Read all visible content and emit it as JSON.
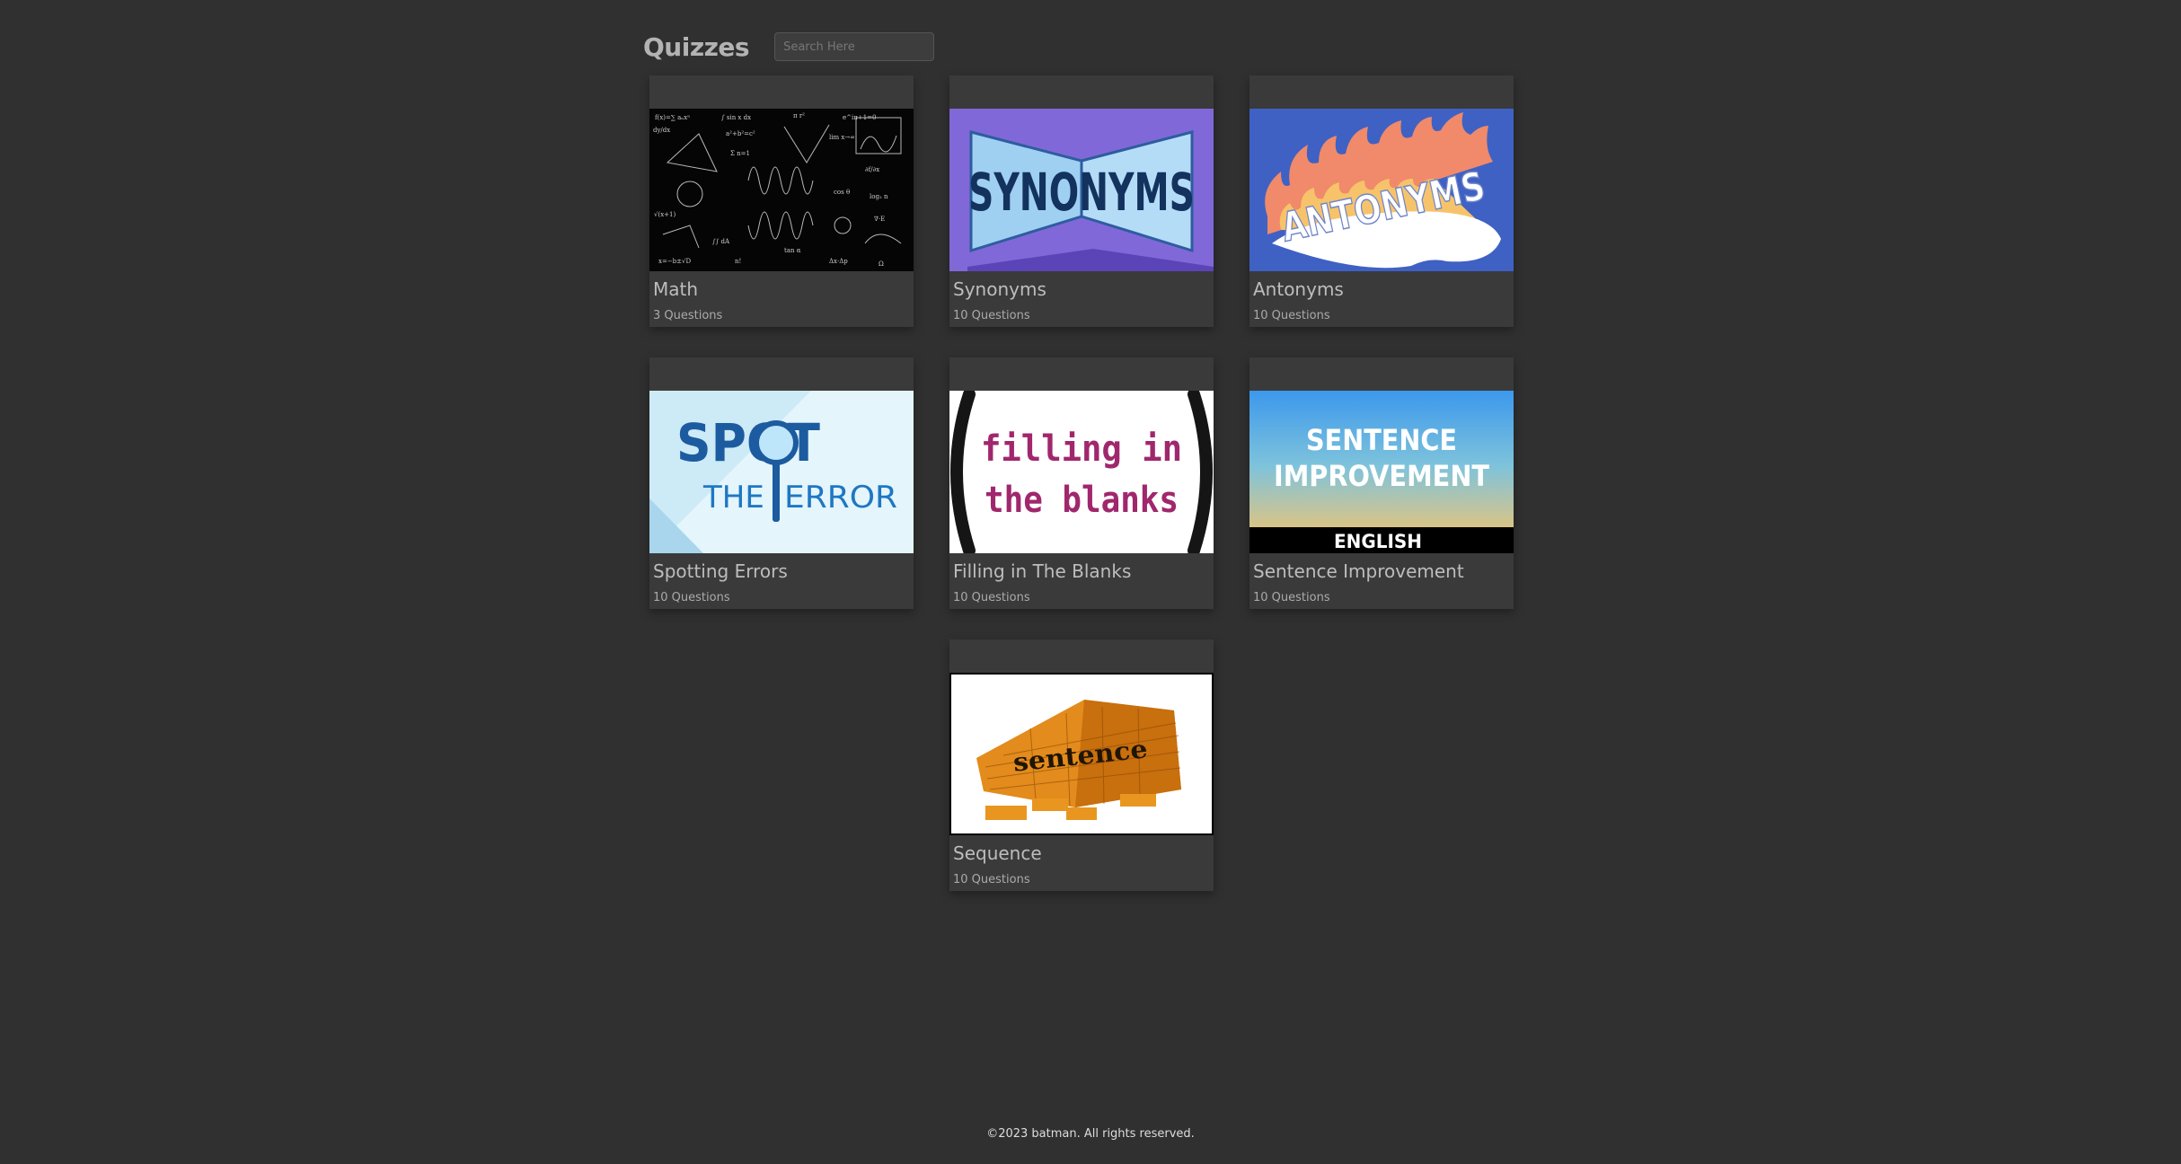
{
  "header": {
    "title": "Quizzes",
    "search_placeholder": "Search Here"
  },
  "quizzes": [
    {
      "title": "Math",
      "count": "3 Questions",
      "image_text": []
    },
    {
      "title": "Synonyms",
      "count": "10 Questions",
      "image_text": [
        "SYNONYMS"
      ]
    },
    {
      "title": "Antonyms",
      "count": "10 Questions",
      "image_text": [
        "ANTONYMS"
      ]
    },
    {
      "title": "Spotting Errors",
      "count": "10 Questions",
      "image_text": [
        "SPOT",
        "THE",
        "ERROR"
      ]
    },
    {
      "title": "Filling in The Blanks",
      "count": "10 Questions",
      "image_text": [
        "filling in",
        "the blanks"
      ]
    },
    {
      "title": "Sentence Improvement",
      "count": "10 Questions",
      "image_text": [
        "SENTENCE",
        "IMPROVEMENT",
        "ENGLISH"
      ]
    },
    {
      "title": "Sequence",
      "count": "10 Questions",
      "image_text": [
        "sentence"
      ]
    }
  ],
  "footer": {
    "text": "©2023 batman. All rights reserved."
  },
  "colors": {
    "background": "#303030",
    "card": "#3a3a3a",
    "text": "#b9b9b9"
  }
}
